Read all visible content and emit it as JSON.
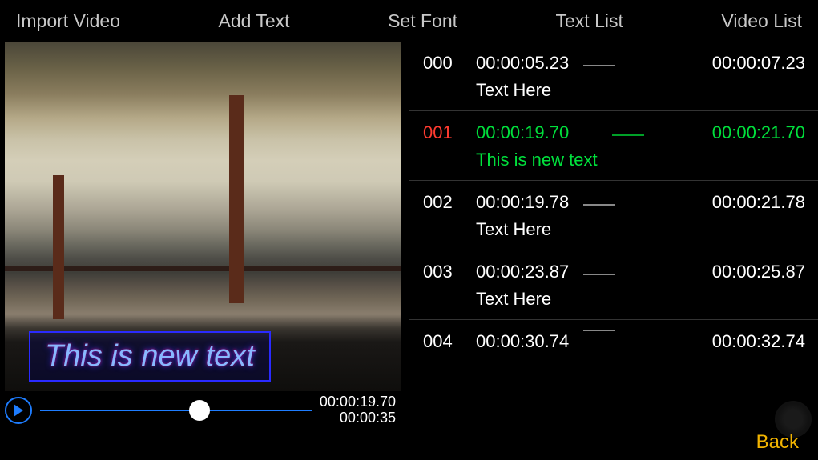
{
  "menu": {
    "import": "Import Video",
    "add_text": "Add Text",
    "set_font": "Set Font",
    "text_list": "Text List",
    "video_list": "Video List"
  },
  "overlay_text": "This is new text",
  "player": {
    "current": "00:00:19.70",
    "duration": "00:00:35"
  },
  "text_items": [
    {
      "idx": "000",
      "start": "00:00:05.23",
      "end": "00:00:07.23",
      "text": "Text Here",
      "active": false
    },
    {
      "idx": "001",
      "start": "00:00:19.70",
      "end": "00:00:21.70",
      "text": "This is new text",
      "active": true
    },
    {
      "idx": "002",
      "start": "00:00:19.78",
      "end": "00:00:21.78",
      "text": "Text Here",
      "active": false
    },
    {
      "idx": "003",
      "start": "00:00:23.87",
      "end": "00:00:25.87",
      "text": "Text Here",
      "active": false
    },
    {
      "idx": "004",
      "start": "00:00:30.74",
      "end": "00:00:32.74",
      "text": "",
      "active": false
    }
  ],
  "back_label": "Back"
}
